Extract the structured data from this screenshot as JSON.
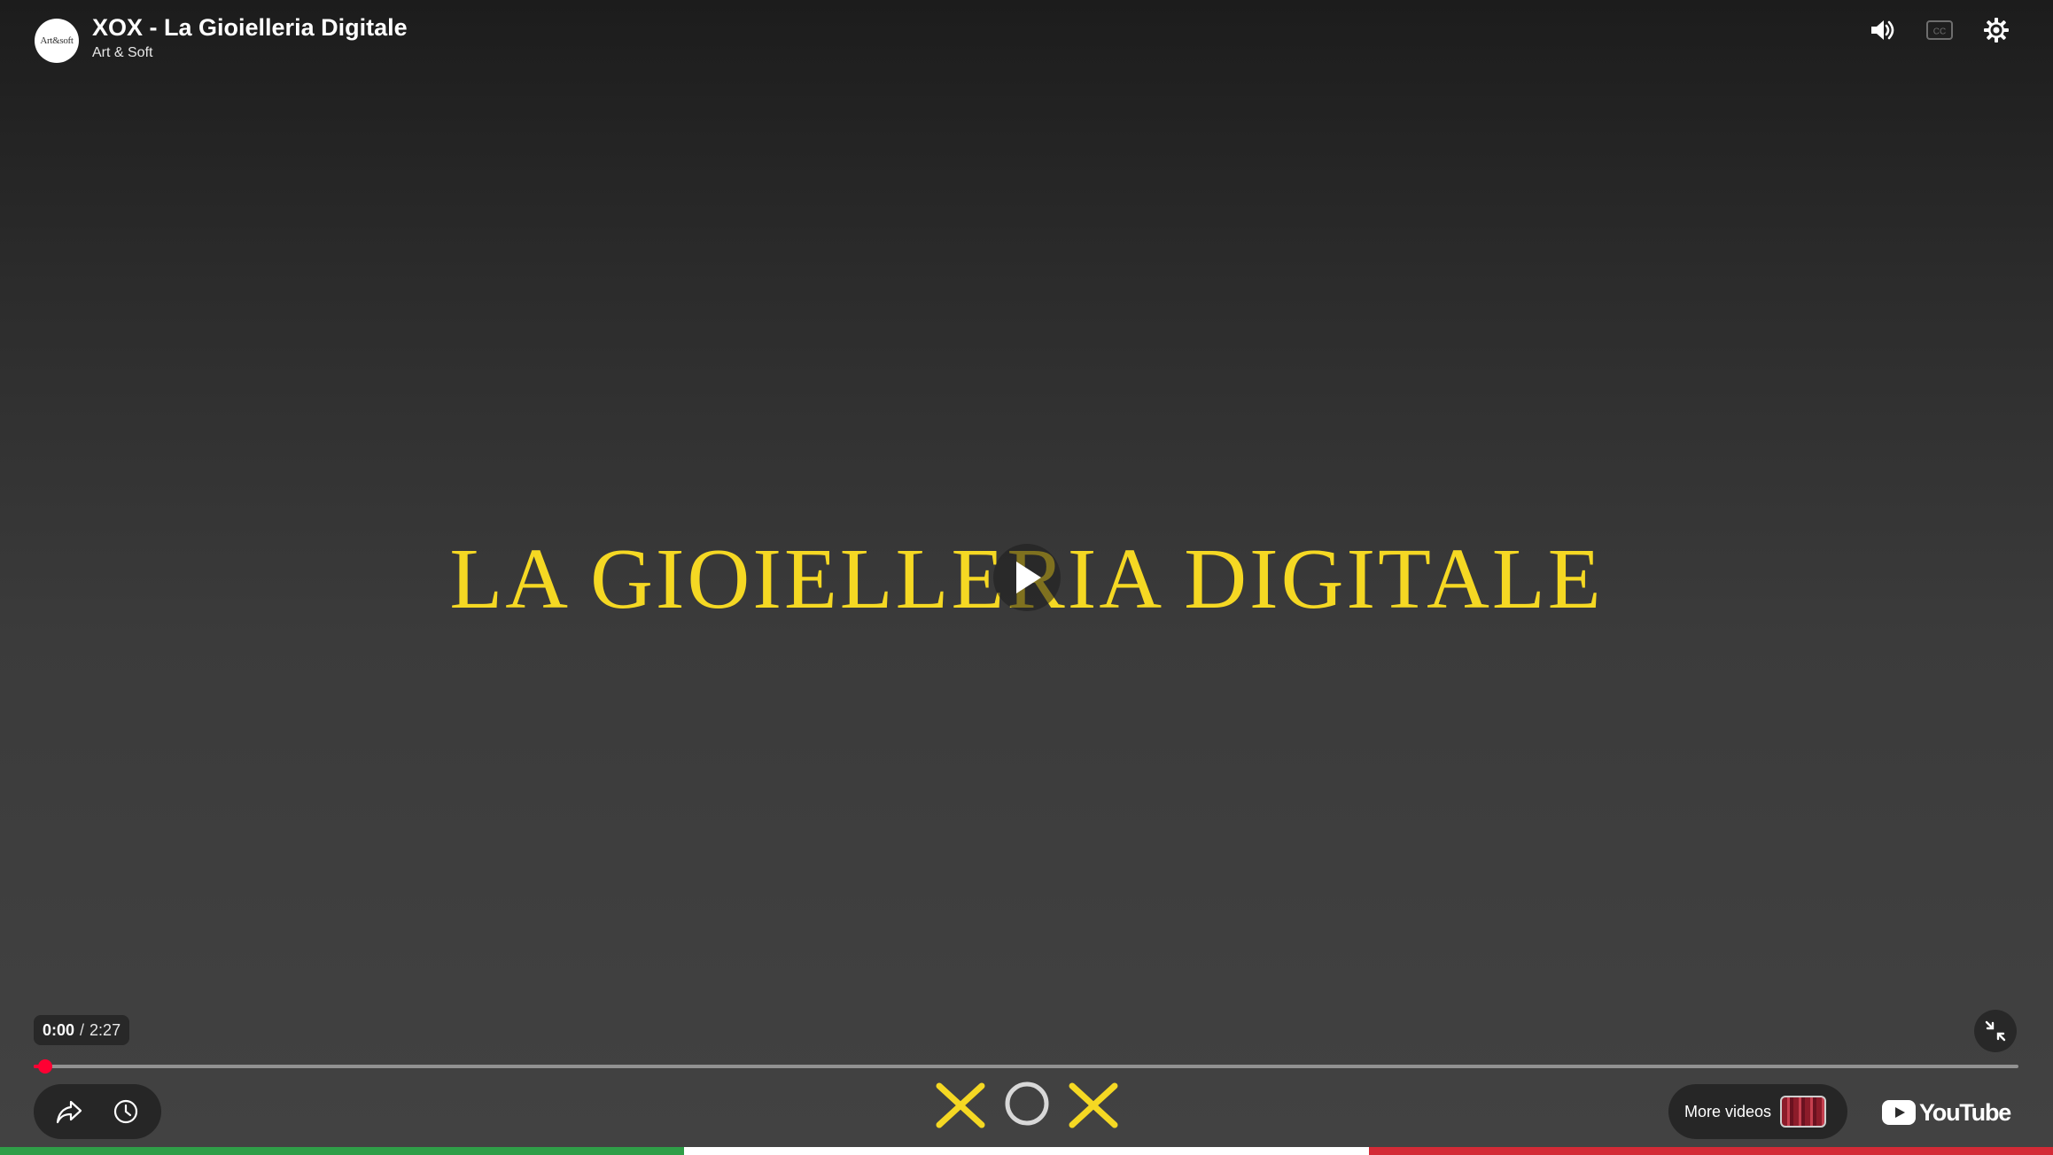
{
  "header": {
    "avatar_text": "Art&soft",
    "title": "XOX - La Gioielleria Digitale",
    "channel": "Art & Soft"
  },
  "top_controls": {
    "volume_icon": "volume-icon",
    "captions_icon": "cc-icon",
    "settings_icon": "gear-icon"
  },
  "video": {
    "overlay_title": "LA GIOIELLERIA DIGITALE",
    "play_icon": "play-icon"
  },
  "playback": {
    "current_time": "0:00",
    "separator": "/",
    "duration": "2:27",
    "progress_fraction": 0.006
  },
  "bottom_controls": {
    "share_icon": "share-icon",
    "watch_later_icon": "clock-icon",
    "more_videos_label": "More videos",
    "fullscreen_exit_icon": "exit-fullscreen-icon",
    "youtube_label": "YouTube"
  },
  "brand_logo": {
    "letters": [
      "X",
      "O",
      "X"
    ],
    "color": "#f5d823"
  },
  "colors": {
    "accent_red": "#ff0033",
    "title_gold": "#f5d823",
    "flag_green": "#2f9e48",
    "flag_white": "#ffffff",
    "flag_red": "#d42a36"
  }
}
